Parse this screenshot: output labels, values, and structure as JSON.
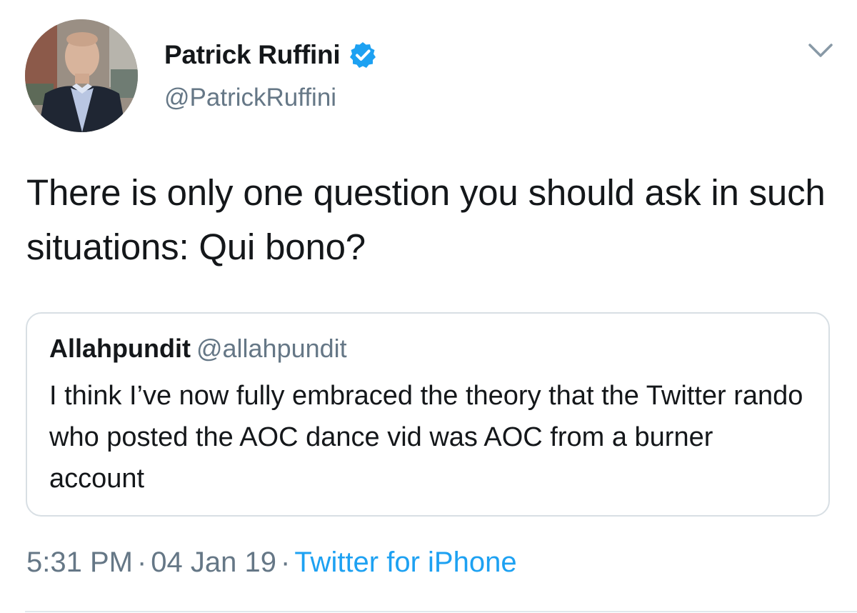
{
  "author": {
    "display_name": "Patrick Ruffini",
    "handle": "@PatrickRuffini",
    "verified": true,
    "avatar_icon": "profile-photo"
  },
  "tweet": {
    "text": "There is only one question you should ask in such situations: Qui bono?"
  },
  "quoted_tweet": {
    "display_name": "Allahpundit",
    "handle": "@allahpundit",
    "text": "I think I’ve now fully embraced the theory that the Twitter rando who posted the AOC dance vid was AOC from a burner account"
  },
  "meta": {
    "time": "5:31 PM",
    "separator": "·",
    "date": "04 Jan 19",
    "source": "Twitter for iPhone"
  },
  "colors": {
    "text_primary": "#14171a",
    "text_secondary": "#657786",
    "accent": "#1da1f2",
    "border": "#d8dfe4"
  },
  "icons": {
    "verified": "verified-badge-icon",
    "menu": "chevron-down-icon"
  }
}
